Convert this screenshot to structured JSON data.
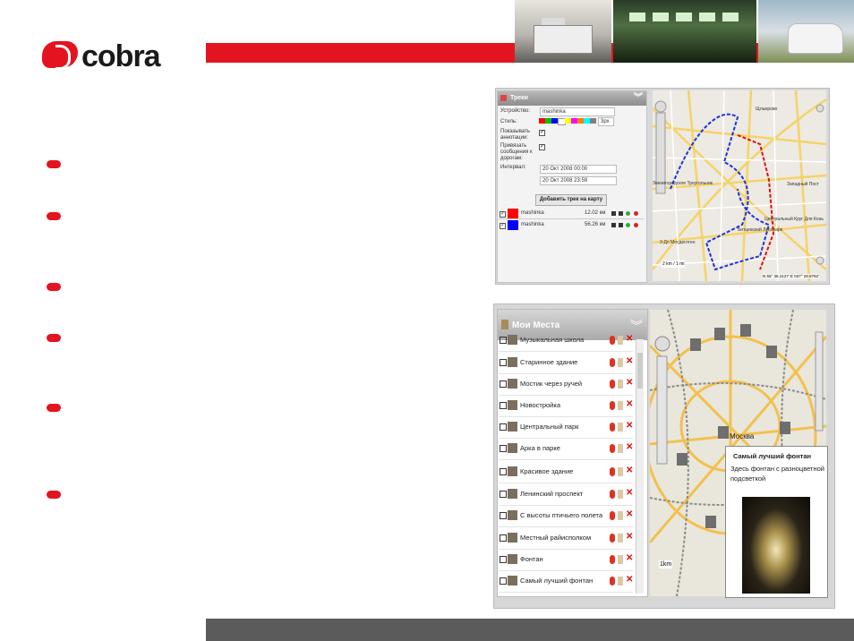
{
  "header": {
    "logo_text": "cobra",
    "accent_color": "#e3141f"
  },
  "tracks_panel": {
    "title": "Треки",
    "device_label": "Устройство:",
    "device_value": "mashinka",
    "style_label": "Стиль:",
    "width_value": "3px",
    "annotations_label": "Показывать аннотации:",
    "snap_label": "Привязать сообщения к дорогам:",
    "interval_label": "Интервал:",
    "interval_from": "20 Окт 2008 00:00",
    "interval_to": "20 Окт 2008 23:59",
    "add_button": "Добавить трек на карту",
    "tracks": [
      {
        "name": "mashinka",
        "distance": "12.02 км",
        "color": "#ff0000"
      },
      {
        "name": "mashinka",
        "distance": "56.26 км",
        "color": "#0000ff"
      }
    ],
    "swatch_colors": [
      "#ff0000",
      "#00c000",
      "#0000ff",
      "#ffffff",
      "#ffff00",
      "#ff00ff",
      "#ff8000",
      "#00ffff",
      "#808080"
    ]
  },
  "map1": {
    "labels": [
      "Звенигородское Треугольник",
      "3-До Мосдентген",
      "Западный Пост",
      "Щлыкрово",
      "Центральный Круг Для Конь",
      "Битцевский Лесопарк"
    ],
    "scale": "2 km / 1 mi",
    "coords": "N 55° 36.4127'  E 037° 29.8792'"
  },
  "places_panel": {
    "title": "Мои Места",
    "items": [
      "Музыкальная школа",
      "Старинное здание",
      "Мостик через ручей",
      "Новостройка",
      "Центральный парк",
      "Арка в парке",
      "Красивое здание",
      "Ленинский проспект",
      "С высоты птичьего полета",
      "Местный райисполком",
      "Фонтан",
      "Самый лучший фонтан"
    ]
  },
  "map2": {
    "city_label": "Москва",
    "scale": "1km",
    "popup_title": "Самый лучший фонтан",
    "popup_desc": "Здесь фонтан с разноцветной подсветкой"
  }
}
